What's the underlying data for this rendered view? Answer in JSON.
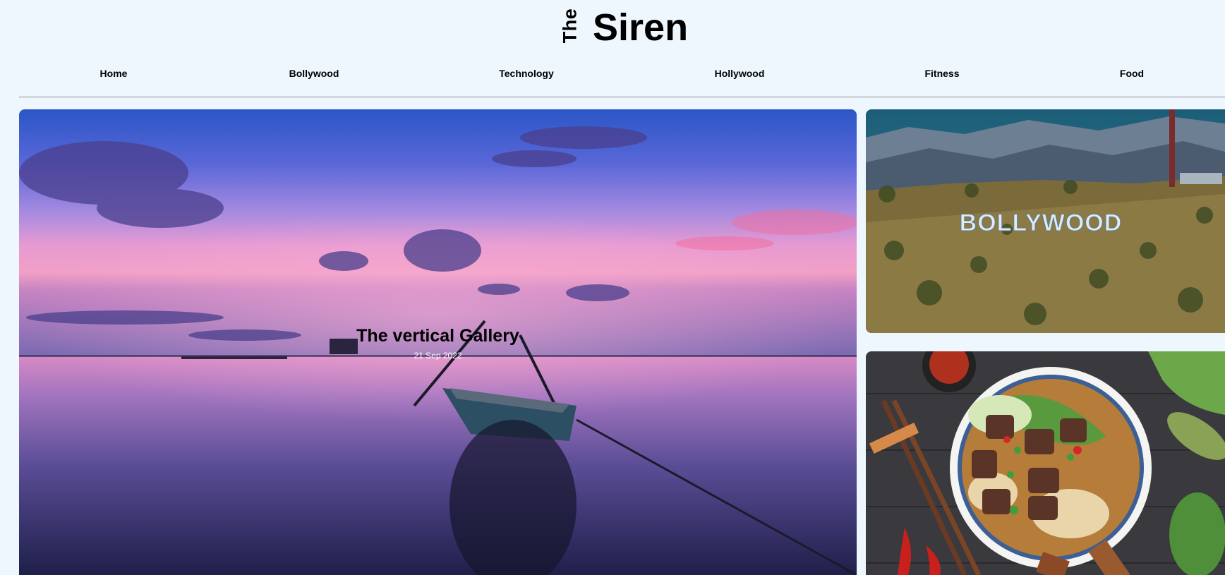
{
  "brand": {
    "prefix": "The",
    "name": "Siren"
  },
  "nav": [
    {
      "label": "Home"
    },
    {
      "label": "Bollywood"
    },
    {
      "label": "Technology"
    },
    {
      "label": "Hollywood"
    },
    {
      "label": "Fitness"
    },
    {
      "label": "Food"
    }
  ],
  "hero": {
    "title": "The vertical Gallery",
    "date": "21 Sep 2022"
  },
  "cards": [
    {
      "sign_text": "BOLLYWOOD"
    },
    {}
  ],
  "colors": {
    "page_background": "#eef7fe",
    "divider": "#8a8a8a"
  }
}
